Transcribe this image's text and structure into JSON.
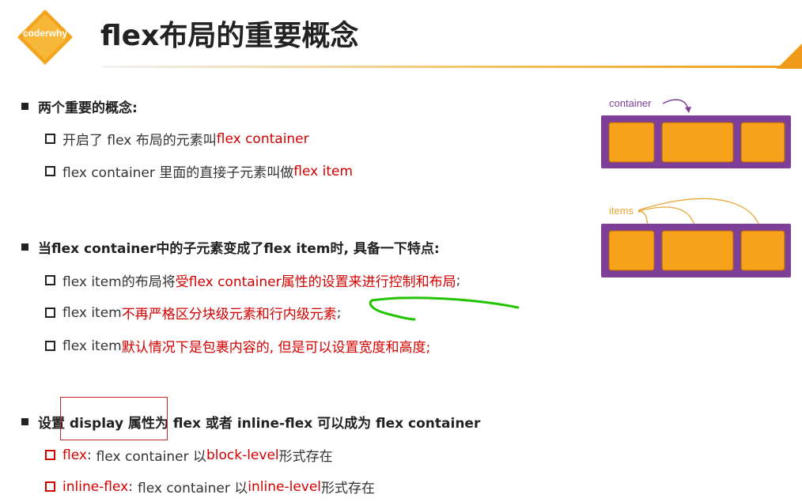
{
  "brand": {
    "logo_text": "coderwhy"
  },
  "title": "flex布局的重要概念",
  "section1": {
    "heading": "两个重要的概念:",
    "items": [
      {
        "prefix": "开启了 flex 布局的元素叫 ",
        "highlight": "flex container"
      },
      {
        "prefix": "flex container 里面的直接子元素叫做 ",
        "highlight": "flex item"
      }
    ]
  },
  "section2": {
    "heading": "当flex container中的子元素变成了flex item时, 具备一下特点:",
    "items": [
      {
        "prefix": "flex item的布局将",
        "highlight": "受flex container属性的设置来进行控制和布局",
        "suffix": ";"
      },
      {
        "prefix": "flex item",
        "highlight": "不再严格区分块级元素和行内级元素",
        "suffix": ";"
      },
      {
        "prefix": "flex item",
        "highlight": "默认情况下是包裹内容的",
        "suffix": ", 但是可以设置宽度和高度;",
        "suffix_red": true
      }
    ]
  },
  "section3": {
    "heading": "设置 display 属性为 flex 或者 inline-flex 可以成为 flex container",
    "items": [
      {
        "term": "flex",
        "colon": ":",
        "mid": "flex container 以 ",
        "highlight": "block-level",
        "suffix": " 形式存在"
      },
      {
        "term": "inline-flex",
        "colon": ":",
        "mid": "flex container 以 ",
        "highlight": "inline-level",
        "suffix": " 形式存在"
      }
    ]
  },
  "diagram": {
    "container_label": "container",
    "items_label": "items",
    "colors": {
      "container": "#7d3f98",
      "item": "#f7a21b",
      "label": "#7d3f98",
      "items_label": "#e8a838",
      "ink": "#22c400"
    }
  }
}
